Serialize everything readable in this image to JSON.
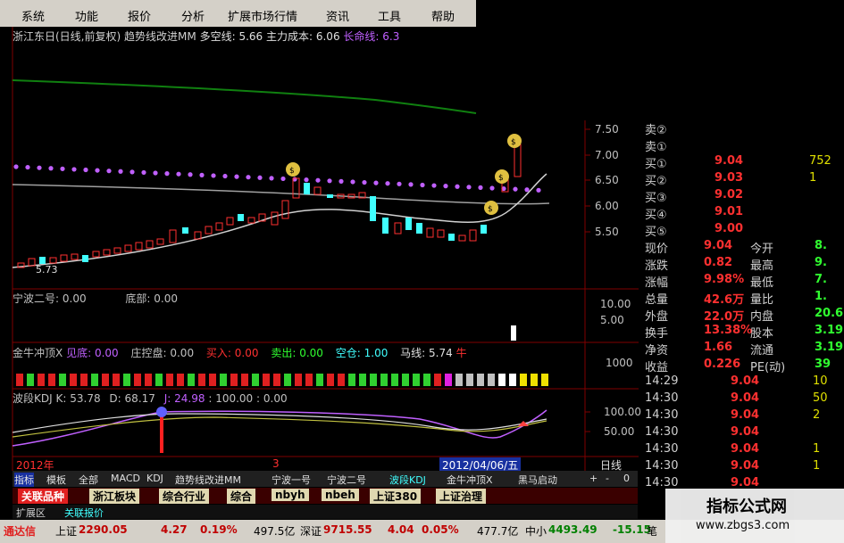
{
  "menu": [
    "系统",
    "功能",
    "报价",
    "分析",
    "扩展市场行情",
    "资讯",
    "工具",
    "帮助"
  ],
  "main_title": {
    "name": "浙江东日(日线,前复权)",
    "indicator": "趋势线改进MM",
    "duo_label": "多空线:",
    "duo_value": "5.66",
    "cost_label": "主力成本:",
    "cost_value": "6.06",
    "life_label": "长命线:",
    "life_value": "6.3"
  },
  "price_axis": [
    "7.50",
    "7.00",
    "6.50",
    "6.00",
    "5.50"
  ],
  "price_low_label": "5.73",
  "panel1": {
    "title": "宁波二号:",
    "v1": "0.00",
    "bottom_label": "底部:",
    "v2": "0.00",
    "axis": [
      "10.00",
      "5.00"
    ]
  },
  "panel2": {
    "title": "金牛冲顶X",
    "jd_label": "见底:",
    "jd_value": "0.00",
    "zk_label": "庄控盘:",
    "zk_value": "0.00",
    "buy_label": "买入:",
    "buy_value": "0.00",
    "sell_label": "卖出:",
    "sell_value": "0.00",
    "empty_label": "空仓:",
    "empty_value": "1.00",
    "ma_label": "马线:",
    "ma_value": "5.74",
    "niu": "牛",
    "axis": "1000"
  },
  "panel3": {
    "title": "波段KDJ",
    "k_label": "K:",
    "k_value": "53.78",
    "d_label": "D:",
    "d_value": "68.17",
    "j_label": "J:",
    "j_value": "24.98",
    "c1": ": 100.00",
    "c2": ": 0.00",
    "axis": [
      "100.00",
      "50.00"
    ]
  },
  "date_bar": {
    "year": "2012年",
    "mid": "3",
    "date": "2012/04/06/五",
    "period": "日线"
  },
  "tabs": [
    "指标",
    "模板",
    "全部",
    "MACD",
    "KDJ",
    "趋势线改进MM",
    "宁波一号",
    "宁波二号",
    "波段KDJ",
    "金牛冲顶X",
    "黑马启动",
    "+",
    "-",
    "0"
  ],
  "cats": [
    "关联品种",
    "浙江板块",
    "综合行业",
    "综合",
    "nbyh",
    "nbeh",
    "上证380",
    "上证治理"
  ],
  "sub_tabs": [
    "扩展区",
    "关联报价"
  ],
  "quote": {
    "sell": [
      {
        "l": "卖②",
        "p": "",
        "v": ""
      },
      {
        "l": "卖①",
        "p": "",
        "v": ""
      }
    ],
    "buy": [
      {
        "l": "买①",
        "p": "9.04",
        "v": "752"
      },
      {
        "l": "买②",
        "p": "9.03",
        "v": "1"
      },
      {
        "l": "买③",
        "p": "9.02",
        "v": ""
      },
      {
        "l": "买④",
        "p": "9.01",
        "v": ""
      },
      {
        "l": "买⑤",
        "p": "9.00",
        "v": ""
      }
    ],
    "stats": [
      {
        "a": "现价",
        "b": "9.04",
        "c": "今开",
        "d": "8."
      },
      {
        "a": "涨跌",
        "b": "0.82",
        "c": "最高",
        "d": "9."
      },
      {
        "a": "涨幅",
        "b": "9.98%",
        "c": "最低",
        "d": "7."
      },
      {
        "a": "总量",
        "b": "42.6万",
        "c": "量比",
        "d": "1."
      },
      {
        "a": "外盘",
        "b": "22.0万",
        "c": "内盘",
        "d": "20.6"
      },
      {
        "a": "换手",
        "b": "13.38%",
        "c": "股本",
        "d": "3.19"
      },
      {
        "a": "净资",
        "b": "1.66",
        "c": "流通",
        "d": "3.19"
      },
      {
        "a": "收益",
        "b": "0.226",
        "c": "PE(动)",
        "d": "39"
      }
    ],
    "ticks": [
      {
        "t": "14:29",
        "p": "9.04",
        "v": "10"
      },
      {
        "t": "14:30",
        "p": "9.04",
        "v": "50"
      },
      {
        "t": "14:30",
        "p": "9.04",
        "v": "2"
      },
      {
        "t": "14:30",
        "p": "9.04",
        "v": ""
      },
      {
        "t": "14:30",
        "p": "9.04",
        "v": "1"
      },
      {
        "t": "14:30",
        "p": "9.04",
        "v": "1"
      },
      {
        "t": "14:30",
        "p": "9.04",
        "v": ""
      }
    ]
  },
  "bottom": {
    "brand": "通达信",
    "sh_label": "上证",
    "sh_value": "2290.05",
    "sh_chg": "4.27",
    "sh_pct": "0.19%",
    "sh_amt": "497.5亿",
    "sz_label": "深证",
    "sz_value": "9715.55",
    "sz_chg": "4.04",
    "sz_pct": "0.05%",
    "sz_amt": "477.7亿",
    "zx_label": "中小",
    "zx_value": "4493.49",
    "zx_chg": "-15.15",
    "end": "笔"
  },
  "watermark": {
    "title": "指标公式网",
    "url": "www.zbgs3.com"
  },
  "colors": {
    "up": "#ff3030",
    "down": "#40ffff",
    "bg": "#000000",
    "grid": "#800000",
    "purple": "#c060ff",
    "green": "#108010"
  }
}
